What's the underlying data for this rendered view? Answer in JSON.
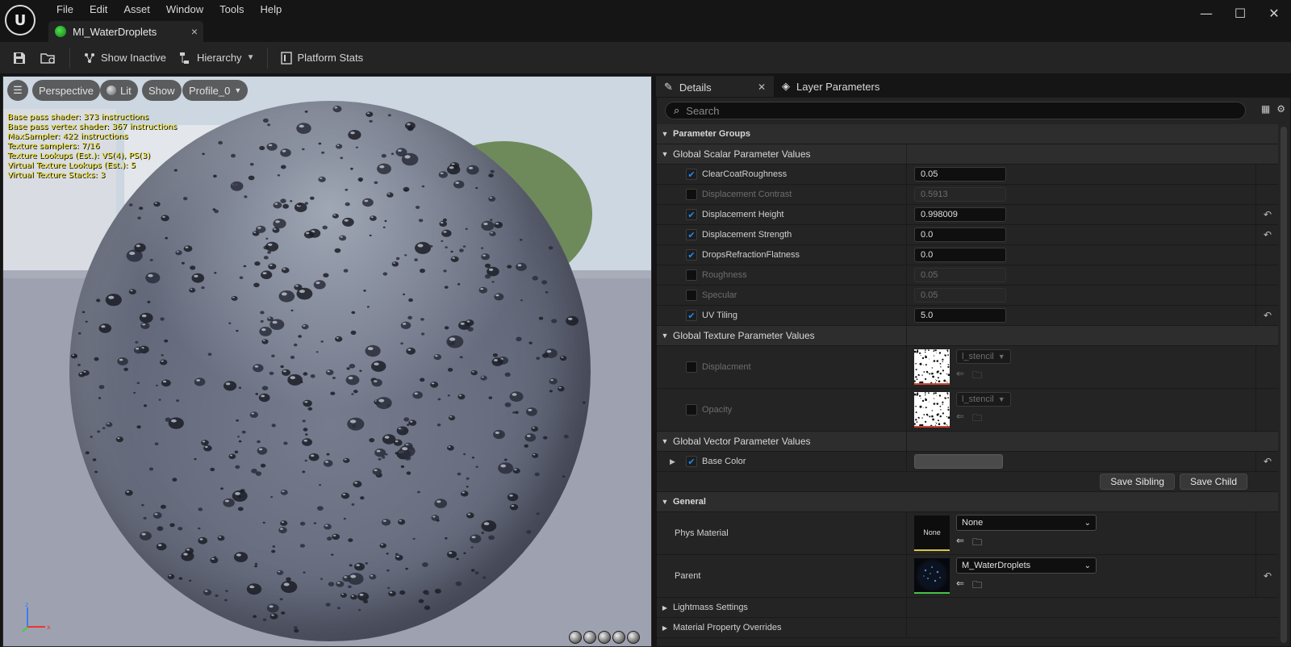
{
  "menu": [
    "File",
    "Edit",
    "Asset",
    "Window",
    "Tools",
    "Help"
  ],
  "doc_tab": {
    "label": "MI_WaterDroplets",
    "close": "×"
  },
  "window_controls": {
    "minimize": "—",
    "maximize": "☐",
    "close": "✕"
  },
  "toolbar": {
    "show_inactive": "Show Inactive",
    "hierarchy": "Hierarchy",
    "platform_stats": "Platform Stats"
  },
  "viewport": {
    "perspective": "Perspective",
    "lit": "Lit",
    "show": "Show",
    "profile": "Profile_0",
    "stats": [
      "Base pass shader: 373 instructions",
      "Base pass vertex shader: 367 instructions",
      "MaxSampler: 422 instructions",
      "Texture samplers: 7/16",
      "Texture Lookups (Est.): VS(4), PS(3)",
      "Virtual Texture Lookups (Est.): 5",
      "Virtual Texture Stacks: 3"
    ]
  },
  "panel": {
    "tab_details": "Details",
    "tab_layers": "Layer Parameters",
    "search_placeholder": "Search"
  },
  "details": {
    "parameter_groups": "Parameter Groups",
    "scalar_header": "Global Scalar Parameter Values",
    "scalars": [
      {
        "name": "ClearCoatRoughness",
        "value": "0.05",
        "enabled": true,
        "reset": false
      },
      {
        "name": "Displacement Contrast",
        "value": "0.5913",
        "enabled": false,
        "reset": false
      },
      {
        "name": "Displacement Height",
        "value": "0.998009",
        "enabled": true,
        "reset": true
      },
      {
        "name": "Displacement Strength",
        "value": "0.0",
        "enabled": true,
        "reset": true
      },
      {
        "name": "DropsRefractionFlatness",
        "value": "0.0",
        "enabled": true,
        "reset": false
      },
      {
        "name": "Roughness",
        "value": "0.05",
        "enabled": false,
        "reset": false
      },
      {
        "name": "Specular",
        "value": "0.05",
        "enabled": false,
        "reset": false
      },
      {
        "name": "UV Tiling",
        "value": "5.0",
        "enabled": true,
        "reset": true
      }
    ],
    "texture_header": "Global Texture Parameter Values",
    "textures": [
      {
        "name": "Displacment",
        "asset": "l_stencil"
      },
      {
        "name": "Opacity",
        "asset": "l_stencil"
      }
    ],
    "vector_header": "Global Vector Parameter Values",
    "vector": {
      "name": "Base Color",
      "color": "#4a4a4a"
    },
    "save_sibling": "Save Sibling",
    "save_child": "Save Child",
    "general_header": "General",
    "phys_material": {
      "label": "Phys Material",
      "thumb": "None",
      "value": "None"
    },
    "parent": {
      "label": "Parent",
      "value": "M_WaterDroplets"
    },
    "lightmass": "Lightmass Settings",
    "overrides": "Material Property Overrides"
  },
  "colors": {
    "accent": "#1e8bff",
    "stats_text": "#f2e31d"
  }
}
